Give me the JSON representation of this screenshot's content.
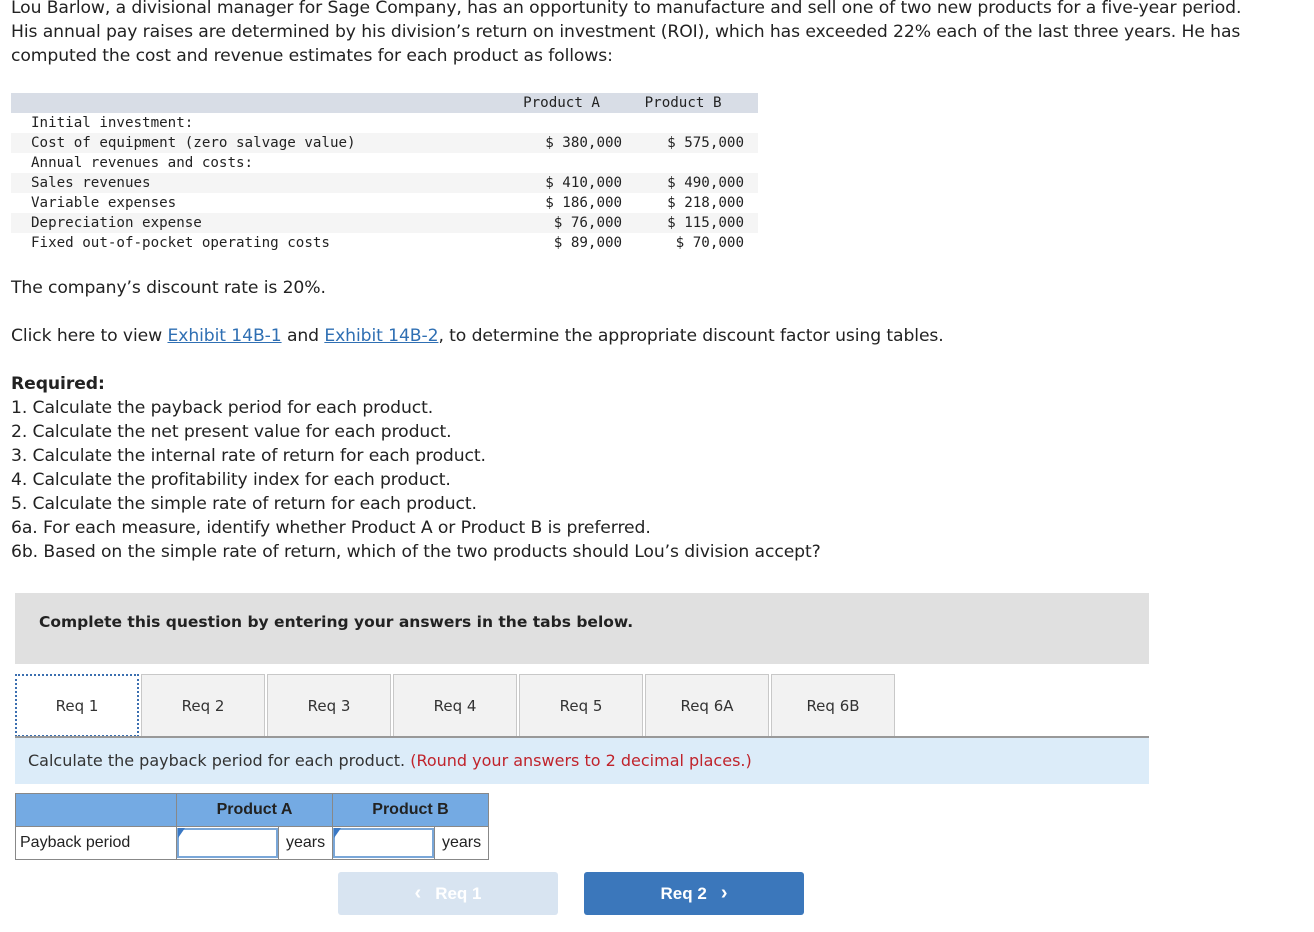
{
  "intro": {
    "paragraph": "Lou Barlow, a divisional manager for Sage Company, has an opportunity to manufacture and sell one of two new products for a five-year period. His annual pay raises are determined by his division’s return on investment (ROI), which has exceeded 22% each of the last three years. He has computed the cost and revenue estimates for each product as follows:"
  },
  "data_table": {
    "headers": [
      "",
      "Product A",
      "Product B"
    ],
    "rows": [
      {
        "label": "Initial investment:",
        "a": "",
        "b": ""
      },
      {
        "label": "Cost of equipment (zero salvage value)",
        "a": "$ 380,000",
        "b": "$ 575,000"
      },
      {
        "label": "Annual revenues and costs:",
        "a": "",
        "b": ""
      },
      {
        "label": "Sales revenues",
        "a": "$ 410,000",
        "b": "$ 490,000"
      },
      {
        "label": "Variable expenses",
        "a": "$ 186,000",
        "b": "$ 218,000"
      },
      {
        "label": "Depreciation expense",
        "a": "$ 76,000",
        "b": "$ 115,000"
      },
      {
        "label": "Fixed out-of-pocket operating costs",
        "a": "$ 89,000",
        "b": "$ 70,000"
      }
    ]
  },
  "discount_text": "The company’s discount rate is 20%.",
  "exhibit_line": {
    "prefix": "Click here to view ",
    "link1": "Exhibit 14B-1",
    "middle": " and ",
    "link2": "Exhibit 14B-2",
    "suffix": ", to determine the appropriate discount factor using tables."
  },
  "required": {
    "heading": "Required:",
    "items": [
      "1. Calculate the payback period for each product.",
      "2. Calculate the net present value for each product.",
      "3. Calculate the internal rate of return for each product.",
      "4. Calculate the profitability index for each product.",
      "5. Calculate the simple rate of return for each product.",
      "6a. For each measure, identify whether Product A or Product B is preferred.",
      "6b. Based on the simple rate of return, which of the two products should Lou’s division accept?"
    ]
  },
  "instructions": "Complete this question by entering your answers in the tabs below.",
  "tabs": [
    {
      "label": "Req 1",
      "active": true
    },
    {
      "label": "Req 2",
      "active": false
    },
    {
      "label": "Req 3",
      "active": false
    },
    {
      "label": "Req 4",
      "active": false
    },
    {
      "label": "Req 5",
      "active": false
    },
    {
      "label": "Req 6A",
      "active": false
    },
    {
      "label": "Req 6B",
      "active": false
    }
  ],
  "prompt": {
    "text": "Calculate the payback period for each product. ",
    "hint": "(Round your answers to 2 decimal places.)"
  },
  "answer_table": {
    "headers": [
      "",
      "Product A",
      "Product B"
    ],
    "row_label": "Payback period",
    "product_a_value": "",
    "product_b_value": "",
    "unit": "years"
  },
  "navigation": {
    "prev_label": "Req 1",
    "next_label": "Req 2",
    "prev_icon": "‹",
    "next_icon": "›"
  },
  "colors": {
    "link": "#2f6fb3",
    "hint": "#c0232b",
    "header_blue": "#74aae3",
    "next_button": "#3b77bb",
    "prev_button_disabled": "#d8e4f1"
  }
}
